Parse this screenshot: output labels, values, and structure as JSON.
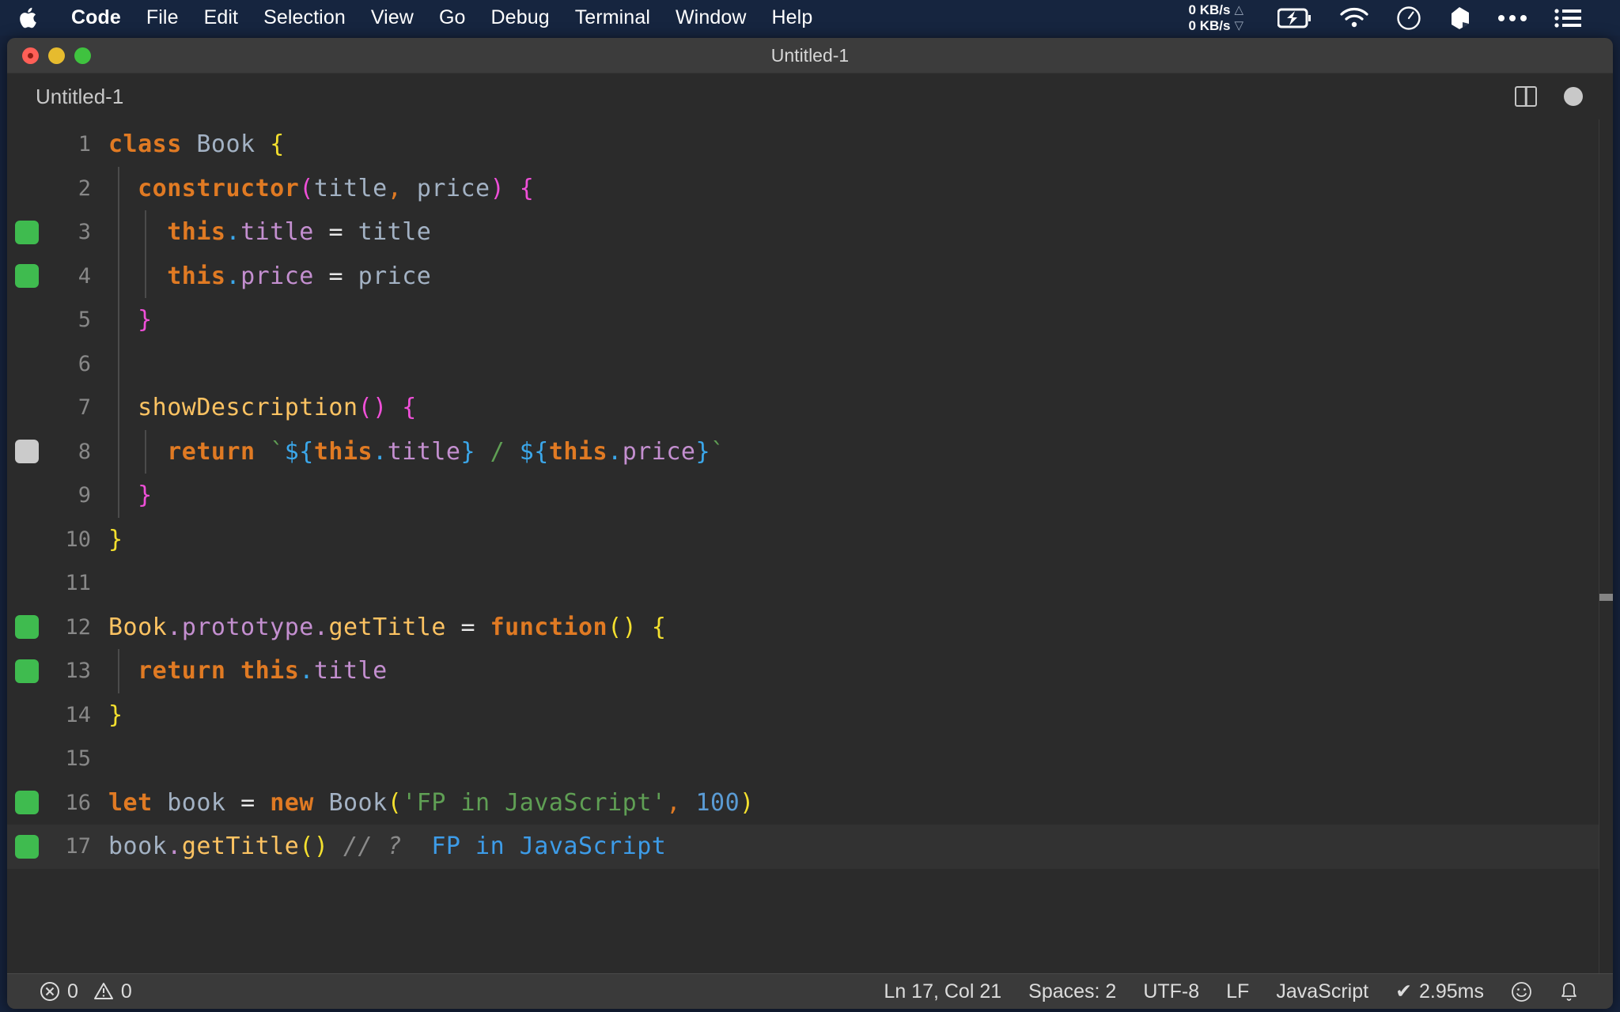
{
  "menubar": {
    "apple_icon": "apple-logo-icon",
    "items": [
      {
        "label": "Code",
        "bold": true
      },
      {
        "label": "File",
        "bold": false
      },
      {
        "label": "Edit",
        "bold": false
      },
      {
        "label": "Selection",
        "bold": false
      },
      {
        "label": "View",
        "bold": false
      },
      {
        "label": "Go",
        "bold": false
      },
      {
        "label": "Debug",
        "bold": false
      },
      {
        "label": "Terminal",
        "bold": false
      },
      {
        "label": "Window",
        "bold": false
      },
      {
        "label": "Help",
        "bold": false
      }
    ],
    "network": {
      "upload": "0 KB/s",
      "download": "0 KB/s",
      "up_arrow": "△",
      "down_arrow": "▽"
    },
    "status_icons": [
      "battery-charging-icon",
      "wifi-icon",
      "clock-icon",
      "dropbox-icon",
      "ellipsis-icon",
      "list-menu-icon"
    ]
  },
  "window": {
    "title": "Untitled-1",
    "traffic_lights": [
      "close",
      "minimize",
      "maximize"
    ]
  },
  "tabbar": {
    "tab_label": "Untitled-1",
    "split_editor_icon": "split-editor-icon",
    "dirty_indicator": "unsaved-dot-icon"
  },
  "editor": {
    "language": "JavaScript",
    "lines": [
      {
        "num": "1",
        "cover": "none",
        "active": false,
        "tokens": [
          {
            "t": "class",
            "c": "t-key"
          },
          {
            "t": " ",
            "c": "t-punct"
          },
          {
            "t": "Book",
            "c": "t-ident"
          },
          {
            "t": " ",
            "c": "t-punct"
          },
          {
            "t": "{",
            "c": "t-brace"
          }
        ]
      },
      {
        "num": "2",
        "cover": "none",
        "active": false,
        "tokens": [
          {
            "t": "  ",
            "c": "t-punct"
          },
          {
            "t": "constructor",
            "c": "t-key"
          },
          {
            "t": "(",
            "c": "t-magenta"
          },
          {
            "t": "title",
            "c": "t-ident"
          },
          {
            "t": ",",
            "c": "t-orange-punct"
          },
          {
            "t": " ",
            "c": "t-punct"
          },
          {
            "t": "price",
            "c": "t-ident"
          },
          {
            "t": ")",
            "c": "t-magenta"
          },
          {
            "t": " ",
            "c": "t-punct"
          },
          {
            "t": "{",
            "c": "t-magenta"
          }
        ]
      },
      {
        "num": "3",
        "cover": "green",
        "active": false,
        "tokens": [
          {
            "t": "    ",
            "c": "t-punct"
          },
          {
            "t": "this",
            "c": "t-key"
          },
          {
            "t": ".",
            "c": "t-blue"
          },
          {
            "t": "title",
            "c": "t-prop"
          },
          {
            "t": " ",
            "c": "t-punct"
          },
          {
            "t": "=",
            "c": "t-punct"
          },
          {
            "t": " ",
            "c": "t-punct"
          },
          {
            "t": "title",
            "c": "t-ident"
          }
        ]
      },
      {
        "num": "4",
        "cover": "green",
        "active": false,
        "tokens": [
          {
            "t": "    ",
            "c": "t-punct"
          },
          {
            "t": "this",
            "c": "t-key"
          },
          {
            "t": ".",
            "c": "t-blue"
          },
          {
            "t": "price",
            "c": "t-prop"
          },
          {
            "t": " ",
            "c": "t-punct"
          },
          {
            "t": "=",
            "c": "t-punct"
          },
          {
            "t": " ",
            "c": "t-punct"
          },
          {
            "t": "price",
            "c": "t-ident"
          }
        ]
      },
      {
        "num": "5",
        "cover": "none",
        "active": false,
        "tokens": [
          {
            "t": "  ",
            "c": "t-punct"
          },
          {
            "t": "}",
            "c": "t-magenta"
          }
        ]
      },
      {
        "num": "6",
        "cover": "none",
        "active": false,
        "tokens": []
      },
      {
        "num": "7",
        "cover": "none",
        "active": false,
        "tokens": [
          {
            "t": "  ",
            "c": "t-punct"
          },
          {
            "t": "showDescription",
            "c": "t-fn"
          },
          {
            "t": "()",
            "c": "t-magenta"
          },
          {
            "t": " ",
            "c": "t-punct"
          },
          {
            "t": "{",
            "c": "t-magenta"
          }
        ]
      },
      {
        "num": "8",
        "cover": "grey",
        "active": false,
        "tokens": [
          {
            "t": "    ",
            "c": "t-punct"
          },
          {
            "t": "return",
            "c": "t-key"
          },
          {
            "t": " ",
            "c": "t-punct"
          },
          {
            "t": "`",
            "c": "t-string"
          },
          {
            "t": "${",
            "c": "t-blue"
          },
          {
            "t": "this",
            "c": "t-key"
          },
          {
            "t": ".",
            "c": "t-blue"
          },
          {
            "t": "title",
            "c": "t-prop"
          },
          {
            "t": "}",
            "c": "t-blue"
          },
          {
            "t": " ",
            "c": "t-punct"
          },
          {
            "t": "/",
            "c": "t-string"
          },
          {
            "t": " ",
            "c": "t-punct"
          },
          {
            "t": "${",
            "c": "t-blue"
          },
          {
            "t": "this",
            "c": "t-key"
          },
          {
            "t": ".",
            "c": "t-blue"
          },
          {
            "t": "price",
            "c": "t-prop"
          },
          {
            "t": "}",
            "c": "t-blue"
          },
          {
            "t": "`",
            "c": "t-string"
          }
        ]
      },
      {
        "num": "9",
        "cover": "none",
        "active": false,
        "tokens": [
          {
            "t": "  ",
            "c": "t-punct"
          },
          {
            "t": "}",
            "c": "t-magenta"
          }
        ]
      },
      {
        "num": "10",
        "cover": "none",
        "active": false,
        "tokens": [
          {
            "t": "}",
            "c": "t-brace"
          }
        ]
      },
      {
        "num": "11",
        "cover": "none",
        "active": false,
        "tokens": []
      },
      {
        "num": "12",
        "cover": "green",
        "active": false,
        "tokens": [
          {
            "t": "Book",
            "c": "t-fn"
          },
          {
            "t": ".",
            "c": "t-prop"
          },
          {
            "t": "prototype",
            "c": "t-prop"
          },
          {
            "t": ".",
            "c": "t-prop"
          },
          {
            "t": "getTitle",
            "c": "t-fn"
          },
          {
            "t": " ",
            "c": "t-punct"
          },
          {
            "t": "=",
            "c": "t-punct"
          },
          {
            "t": " ",
            "c": "t-punct"
          },
          {
            "t": "function",
            "c": "t-key"
          },
          {
            "t": "()",
            "c": "t-brace"
          },
          {
            "t": " ",
            "c": "t-punct"
          },
          {
            "t": "{",
            "c": "t-brace"
          }
        ]
      },
      {
        "num": "13",
        "cover": "green",
        "active": false,
        "tokens": [
          {
            "t": "  ",
            "c": "t-punct"
          },
          {
            "t": "return",
            "c": "t-key"
          },
          {
            "t": " ",
            "c": "t-punct"
          },
          {
            "t": "this",
            "c": "t-key"
          },
          {
            "t": ".",
            "c": "t-blue"
          },
          {
            "t": "title",
            "c": "t-prop"
          }
        ]
      },
      {
        "num": "14",
        "cover": "none",
        "active": false,
        "tokens": [
          {
            "t": "}",
            "c": "t-brace"
          }
        ]
      },
      {
        "num": "15",
        "cover": "none",
        "active": false,
        "tokens": []
      },
      {
        "num": "16",
        "cover": "green",
        "active": false,
        "tokens": [
          {
            "t": "let",
            "c": "t-key"
          },
          {
            "t": " ",
            "c": "t-punct"
          },
          {
            "t": "book",
            "c": "t-ident"
          },
          {
            "t": " ",
            "c": "t-punct"
          },
          {
            "t": "=",
            "c": "t-punct"
          },
          {
            "t": " ",
            "c": "t-punct"
          },
          {
            "t": "new",
            "c": "t-key"
          },
          {
            "t": " ",
            "c": "t-punct"
          },
          {
            "t": "Book",
            "c": "t-ident"
          },
          {
            "t": "(",
            "c": "t-brace"
          },
          {
            "t": "'FP in JavaScript'",
            "c": "t-string"
          },
          {
            "t": ",",
            "c": "t-orange-punct"
          },
          {
            "t": " ",
            "c": "t-punct"
          },
          {
            "t": "100",
            "c": "t-num"
          },
          {
            "t": ")",
            "c": "t-brace"
          }
        ]
      },
      {
        "num": "17",
        "cover": "green",
        "active": true,
        "tokens": [
          {
            "t": "book",
            "c": "t-ident"
          },
          {
            "t": ".",
            "c": "t-prop"
          },
          {
            "t": "getTitle",
            "c": "t-fn"
          },
          {
            "t": "()",
            "c": "t-brace"
          },
          {
            "t": " ",
            "c": "t-punct"
          },
          {
            "t": "// ?",
            "c": "t-comment"
          },
          {
            "t": "  ",
            "c": "t-punct"
          },
          {
            "t": "FP in JavaScript",
            "c": "t-result"
          }
        ]
      }
    ]
  },
  "statusbar": {
    "errors_icon": "error-circle-icon",
    "errors_count": "0",
    "warnings_icon": "warning-triangle-icon",
    "warnings_count": "0",
    "cursor_position": "Ln 17, Col 21",
    "indentation": "Spaces: 2",
    "encoding": "UTF-8",
    "eol": "LF",
    "language_mode": "JavaScript",
    "quokka_status": "2.95ms",
    "quokka_check": "✔",
    "feedback_icon": "smiley-icon",
    "notifications_icon": "bell-icon"
  },
  "colors": {
    "menubar_bg": "#16253f",
    "window_bg": "#2b2b2b",
    "titlebar_bg": "#3c3c3c",
    "statusbar_bg": "#3a3a3a",
    "coverage_green": "#3fbb4f",
    "coverage_grey": "#cbcbcb",
    "active_line": "#323232"
  }
}
